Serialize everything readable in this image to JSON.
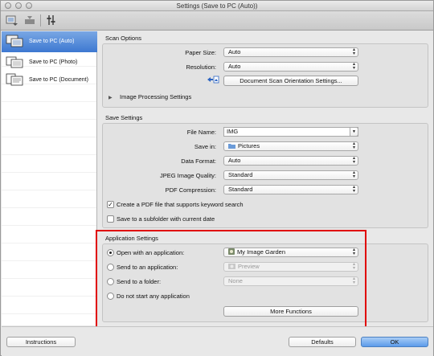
{
  "window": {
    "title": "Settings (Save to PC (Auto))"
  },
  "toolbar": {
    "icons": [
      "scan-from-computer-icon",
      "scan-from-operation-panel-icon",
      "general-settings-icon"
    ]
  },
  "sidebar": {
    "items": [
      {
        "label": "Save to PC (Auto)",
        "active": true
      },
      {
        "label": "Save to PC (Photo)",
        "active": false
      },
      {
        "label": "Save to PC (Document)",
        "active": false
      }
    ]
  },
  "scan_options": {
    "title": "Scan Options",
    "paper_size_label": "Paper Size:",
    "paper_size_value": "Auto",
    "resolution_label": "Resolution:",
    "resolution_value": "Auto",
    "orientation_button": "Document Scan Orientation Settings...",
    "image_processing_label": "Image Processing Settings"
  },
  "save_settings": {
    "title": "Save Settings",
    "file_name_label": "File Name:",
    "file_name_value": "IMG",
    "save_in_label": "Save in:",
    "save_in_value": "Pictures",
    "data_format_label": "Data Format:",
    "data_format_value": "Auto",
    "jpeg_quality_label": "JPEG Image Quality:",
    "jpeg_quality_value": "Standard",
    "pdf_compression_label": "PDF Compression:",
    "pdf_compression_value": "Standard",
    "keyword_pdf_label": "Create a PDF file that supports keyword search",
    "keyword_pdf_checked": true,
    "subfolder_label": "Save to a subfolder with current date",
    "subfolder_checked": false
  },
  "application_settings": {
    "title": "Application Settings",
    "open_with_label": "Open with an application:",
    "open_with_value": "My Image Garden",
    "send_app_label": "Send to an application:",
    "send_app_value": "Preview",
    "send_folder_label": "Send to a folder:",
    "send_folder_value": "None",
    "do_not_start_label": "Do not start any application",
    "selected_option": "open_with",
    "more_functions_button": "More Functions"
  },
  "footer": {
    "instructions_button": "Instructions",
    "defaults_button": "Defaults",
    "ok_button": "OK"
  },
  "colors": {
    "highlight": "#e00000",
    "selection": "#3d78d1"
  }
}
